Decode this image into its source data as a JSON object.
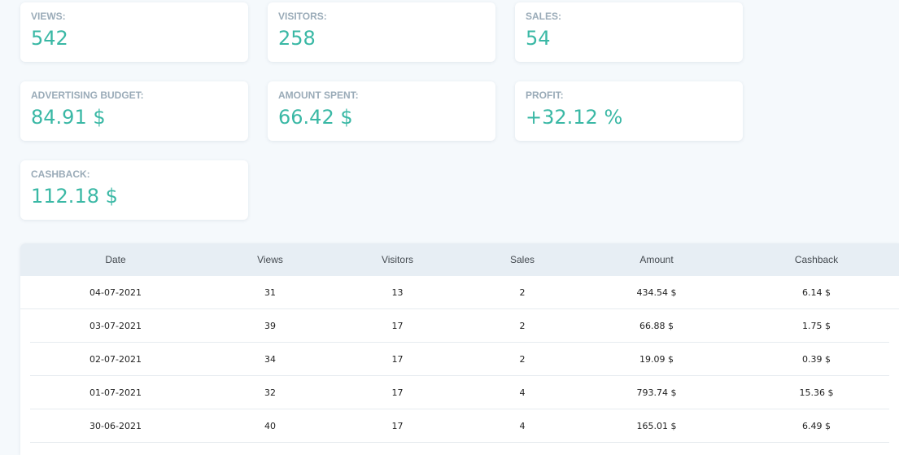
{
  "stats": {
    "views": {
      "label": "VIEWS:",
      "value": "542"
    },
    "visitors": {
      "label": "VISITORS:",
      "value": "258"
    },
    "sales": {
      "label": "SALES:",
      "value": "54"
    },
    "budget": {
      "label": "ADVERTISING BUDGET:",
      "value": "84.91 $"
    },
    "spent": {
      "label": "AMOUNT SPENT:",
      "value": "66.42 $"
    },
    "profit": {
      "label": "PROFIT:",
      "value": "+32.12 %"
    },
    "cashback": {
      "label": "CASHBACK:",
      "value": "112.18 $"
    }
  },
  "table": {
    "headers": [
      "Date",
      "Views",
      "Visitors",
      "Sales",
      "Amount",
      "Cashback"
    ],
    "rows": [
      [
        "04-07-2021",
        "31",
        "13",
        "2",
        "434.54 $",
        "6.14 $"
      ],
      [
        "03-07-2021",
        "39",
        "17",
        "2",
        "66.88 $",
        "1.75 $"
      ],
      [
        "02-07-2021",
        "34",
        "17",
        "2",
        "19.09 $",
        "0.39 $"
      ],
      [
        "01-07-2021",
        "32",
        "17",
        "4",
        "793.74 $",
        "15.36 $"
      ],
      [
        "30-06-2021",
        "40",
        "17",
        "4",
        "165.01 $",
        "6.49 $"
      ]
    ]
  },
  "colors": {
    "accent": "#3ab8a5",
    "label": "#9aabb8",
    "header_bg": "#e7eef4",
    "page_bg": "#f5f9fc"
  }
}
